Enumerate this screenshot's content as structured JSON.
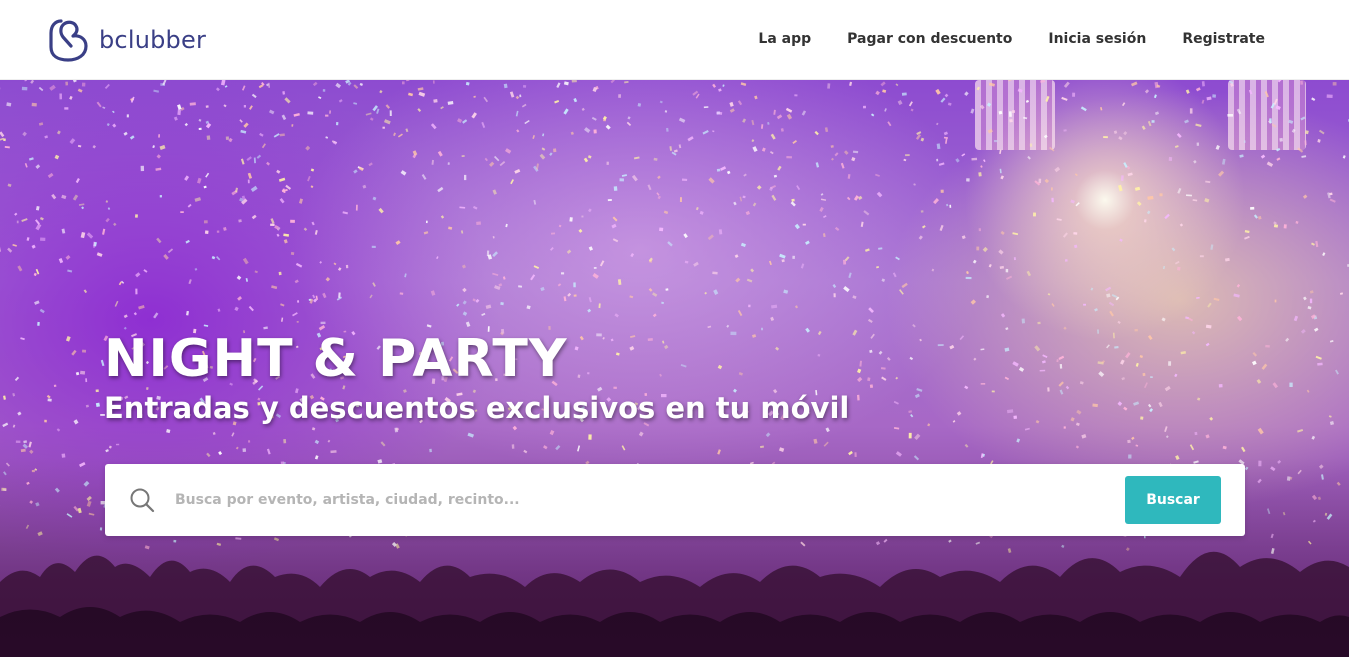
{
  "brand": {
    "name": "bclubber",
    "color": "#3a3f86"
  },
  "nav": {
    "items": [
      {
        "label": "La app"
      },
      {
        "label": "Pagar con descuento"
      },
      {
        "label": "Inicia sesión"
      },
      {
        "label": "Registrate"
      }
    ]
  },
  "hero": {
    "title": "NIGHT & PARTY",
    "subtitle": "Entradas y descuentos exclusivos en tu móvil"
  },
  "search": {
    "placeholder": "Busca por evento, artista, ciudad, recinto...",
    "value": "",
    "button_label": "Buscar",
    "icon": "search-icon",
    "button_color": "#2fb8bd"
  }
}
